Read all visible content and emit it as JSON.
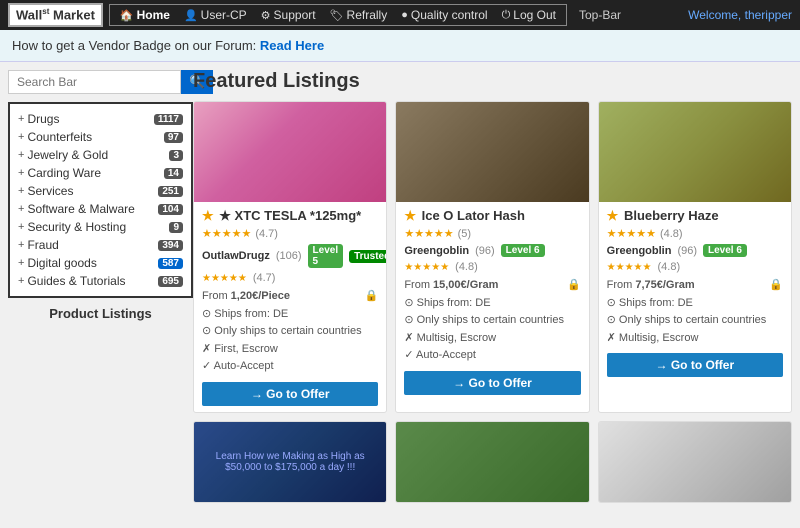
{
  "topbar": {
    "logo": "Wall",
    "logo_sup": "st",
    "logo_suffix": "Market",
    "label": "Top-Bar",
    "welcome_prefix": "Welcome,",
    "welcome_user": "theripper",
    "nav": [
      {
        "id": "home",
        "icon": "🏠",
        "label": "Home",
        "active": true
      },
      {
        "id": "user-cp",
        "icon": "👤",
        "label": "User-CP",
        "active": false
      },
      {
        "id": "support",
        "icon": "⚙",
        "label": "Support",
        "active": false
      },
      {
        "id": "refrally",
        "icon": "🏷",
        "label": "Refrally",
        "active": false
      },
      {
        "id": "quality-control",
        "icon": "●",
        "label": "Quality control",
        "active": false
      },
      {
        "id": "log-out",
        "icon": "⏻",
        "label": "Log Out",
        "active": false
      }
    ]
  },
  "infobar": {
    "text": "How to get a Vendor Badge on our Forum:",
    "link": "Read Here"
  },
  "search": {
    "placeholder": "Search Bar"
  },
  "categories": [
    {
      "id": "drugs",
      "label": "Drugs",
      "count": "1117",
      "badge_class": ""
    },
    {
      "id": "counterfeits",
      "label": "Counterfeits",
      "count": "97",
      "badge_class": ""
    },
    {
      "id": "jewelry",
      "label": "Jewelry & Gold",
      "count": "3",
      "badge_class": ""
    },
    {
      "id": "carding",
      "label": "Carding Ware",
      "count": "14",
      "badge_class": ""
    },
    {
      "id": "services",
      "label": "Services",
      "count": "251",
      "badge_class": ""
    },
    {
      "id": "software",
      "label": "Software & Malware",
      "count": "104",
      "badge_class": ""
    },
    {
      "id": "security",
      "label": "Security & Hosting",
      "count": "9",
      "badge_class": ""
    },
    {
      "id": "fraud",
      "label": "Fraud",
      "count": "394",
      "badge_class": ""
    },
    {
      "id": "digital",
      "label": "Digital goods",
      "count": "587",
      "badge_class": "blue"
    },
    {
      "id": "guides",
      "label": "Guides & Tutorials",
      "count": "695",
      "badge_class": ""
    }
  ],
  "sidebar_bottom_label": "Product Listings",
  "featured_title": "Featured Listings",
  "listings": [
    {
      "id": "xtc",
      "title": "★ XTC TESLA *125mg*",
      "rating_val": "(4.7)",
      "stars": "★★★★★",
      "seller": "OutlawDrugz",
      "seller_count": "(106)",
      "seller_stars": "★★★★★",
      "seller_rating": "(4.7)",
      "level": "Level 5",
      "trusted": "Trusted",
      "from": "From 1,20€/Piece",
      "ships": "Ships from: DE",
      "ships_note": "Only ships to certain countries",
      "escrow": "First, Escrow",
      "accept": "Auto-Accept",
      "img_class": "img-pink"
    },
    {
      "id": "hash",
      "title": "★ Ice O Lator Hash",
      "rating_val": "(5)",
      "stars": "★★★★★",
      "seller": "Greengoblin",
      "seller_count": "(96)",
      "seller_stars": "★★★★★",
      "seller_rating": "(4.8)",
      "level": "Level 6",
      "trusted": "",
      "from": "From 15,00€/Gram",
      "ships": "Ships from: DE",
      "ships_note": "Only ships to certain countries",
      "escrow": "Multisig, Escrow",
      "accept": "Auto-Accept",
      "img_class": "img-hash"
    },
    {
      "id": "haze",
      "title": "★ Blueberry Haze",
      "rating_val": "(4.8)",
      "stars": "★★★★★",
      "seller": "Greengoblin",
      "seller_count": "(96)",
      "seller_stars": "★★★★★",
      "seller_rating": "(4.8)",
      "level": "Level 6",
      "trusted": "",
      "from": "From 7,75€/Gram",
      "ships": "Ships from: DE",
      "ships_note": "Only ships to certain countries",
      "escrow": "Multisig, Escrow",
      "accept": "",
      "img_class": "img-haze"
    }
  ],
  "bottom_listings": [
    {
      "img_class": "img-learn"
    },
    {
      "img_class": "img-green"
    },
    {
      "img_class": "img-white"
    }
  ],
  "go_offer_label": "→ Go to Offer"
}
